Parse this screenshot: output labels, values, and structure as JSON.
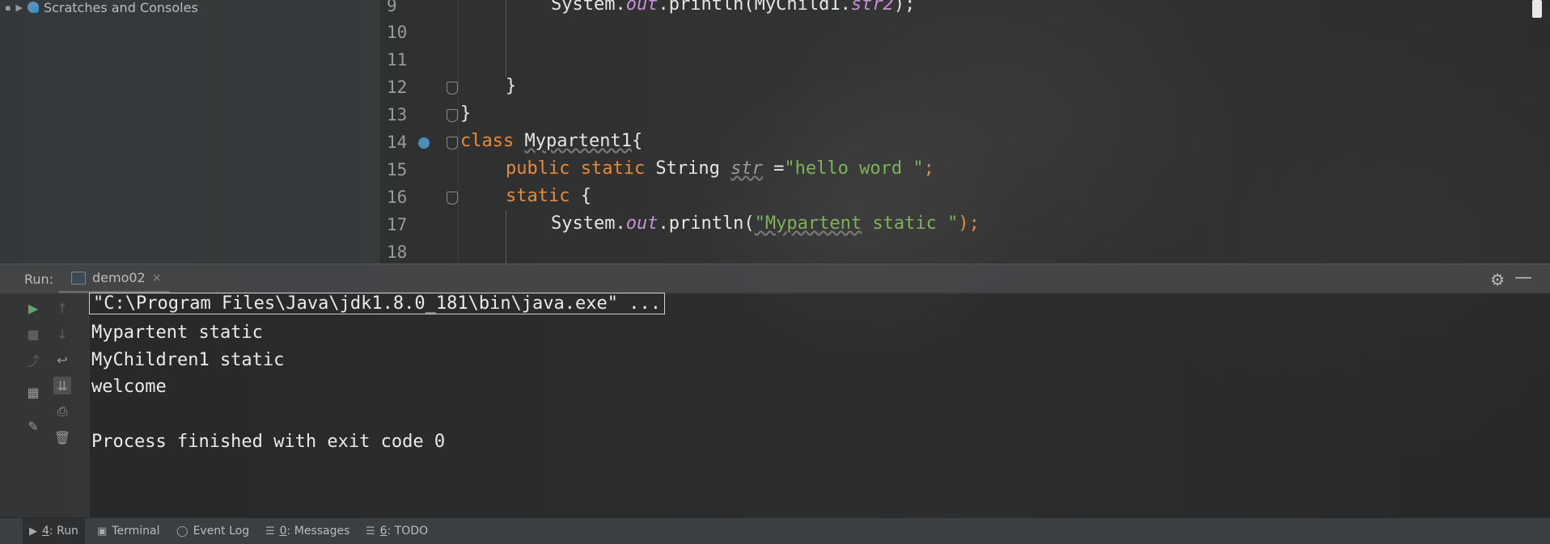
{
  "project_panel": {
    "tree_item": "Scratches and Consoles"
  },
  "editor": {
    "lines": [
      {
        "num": "9"
      },
      {
        "num": "10"
      },
      {
        "num": "11"
      },
      {
        "num": "12"
      },
      {
        "num": "13"
      },
      {
        "num": "14"
      },
      {
        "num": "15"
      },
      {
        "num": "16"
      },
      {
        "num": "17"
      },
      {
        "num": "18"
      }
    ],
    "code": {
      "l9_a": "System.",
      "l9_b": "out",
      "l9_c": ".println(MyChild1.",
      "l9_d": "str2",
      "l9_e": ");",
      "l12": "}",
      "l13": "}",
      "l14_kw": "class",
      "l14_name": "Mypartent1",
      "l14_rest": "{",
      "l15_kw": "public static",
      "l15_type": " String ",
      "l15_fld": "str",
      "l15_eq": " =",
      "l15_str": "\"hello word \"",
      "l15_end": ";",
      "l16_kw": "static",
      "l16_rest": " {",
      "l17_a": "System.",
      "l17_b": "out",
      "l17_c": ".println(",
      "l17_str1": "\"Mypartent",
      "l17_str2": " static \"",
      "l17_end": ");"
    }
  },
  "run_window": {
    "label": "Run:",
    "tab": "demo02",
    "tab_close": "×"
  },
  "console": {
    "command": "\"C:\\Program Files\\Java\\jdk1.8.0_181\\bin\\java.exe\" ...",
    "output": [
      "Mypartent static",
      "MyChildren1 static",
      "welcome",
      "",
      "Process finished with exit code 0"
    ]
  },
  "bottom_bar": {
    "run_mn": "4",
    "run_label": ": Run",
    "terminal": "Terminal",
    "event_log": "Event Log",
    "messages_mn": "0",
    "messages_label": ": Messages",
    "todo_mn": "6",
    "todo_label": ": TODO"
  },
  "colors": {
    "keyword": "#e88a3a",
    "string": "#7cb35a",
    "field": "#c98fd8",
    "run_green": "#59a869"
  }
}
